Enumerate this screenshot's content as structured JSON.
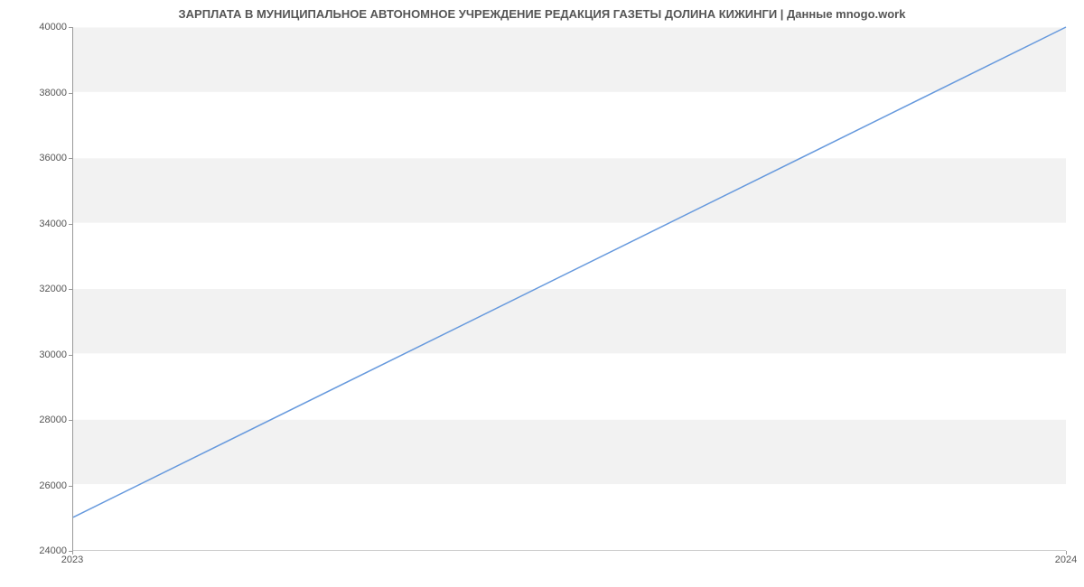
{
  "chart_data": {
    "type": "line",
    "title": "ЗАРПЛАТА В МУНИЦИПАЛЬНОЕ АВТОНОМНОЕ УЧРЕЖДЕНИЕ РЕДАКЦИЯ ГАЗЕТЫ ДОЛИНА КИЖИНГИ | Данные mnogo.work",
    "x": [
      2023,
      2024
    ],
    "values": [
      25000,
      40000
    ],
    "xlabel": "",
    "ylabel": "",
    "xlim": [
      2023,
      2024
    ],
    "ylim": [
      24000,
      40000
    ],
    "y_ticks": [
      24000,
      26000,
      28000,
      30000,
      32000,
      34000,
      36000,
      38000,
      40000
    ],
    "x_ticks": [
      2023,
      2024
    ],
    "line_color": "#6699dd",
    "grid": true
  }
}
